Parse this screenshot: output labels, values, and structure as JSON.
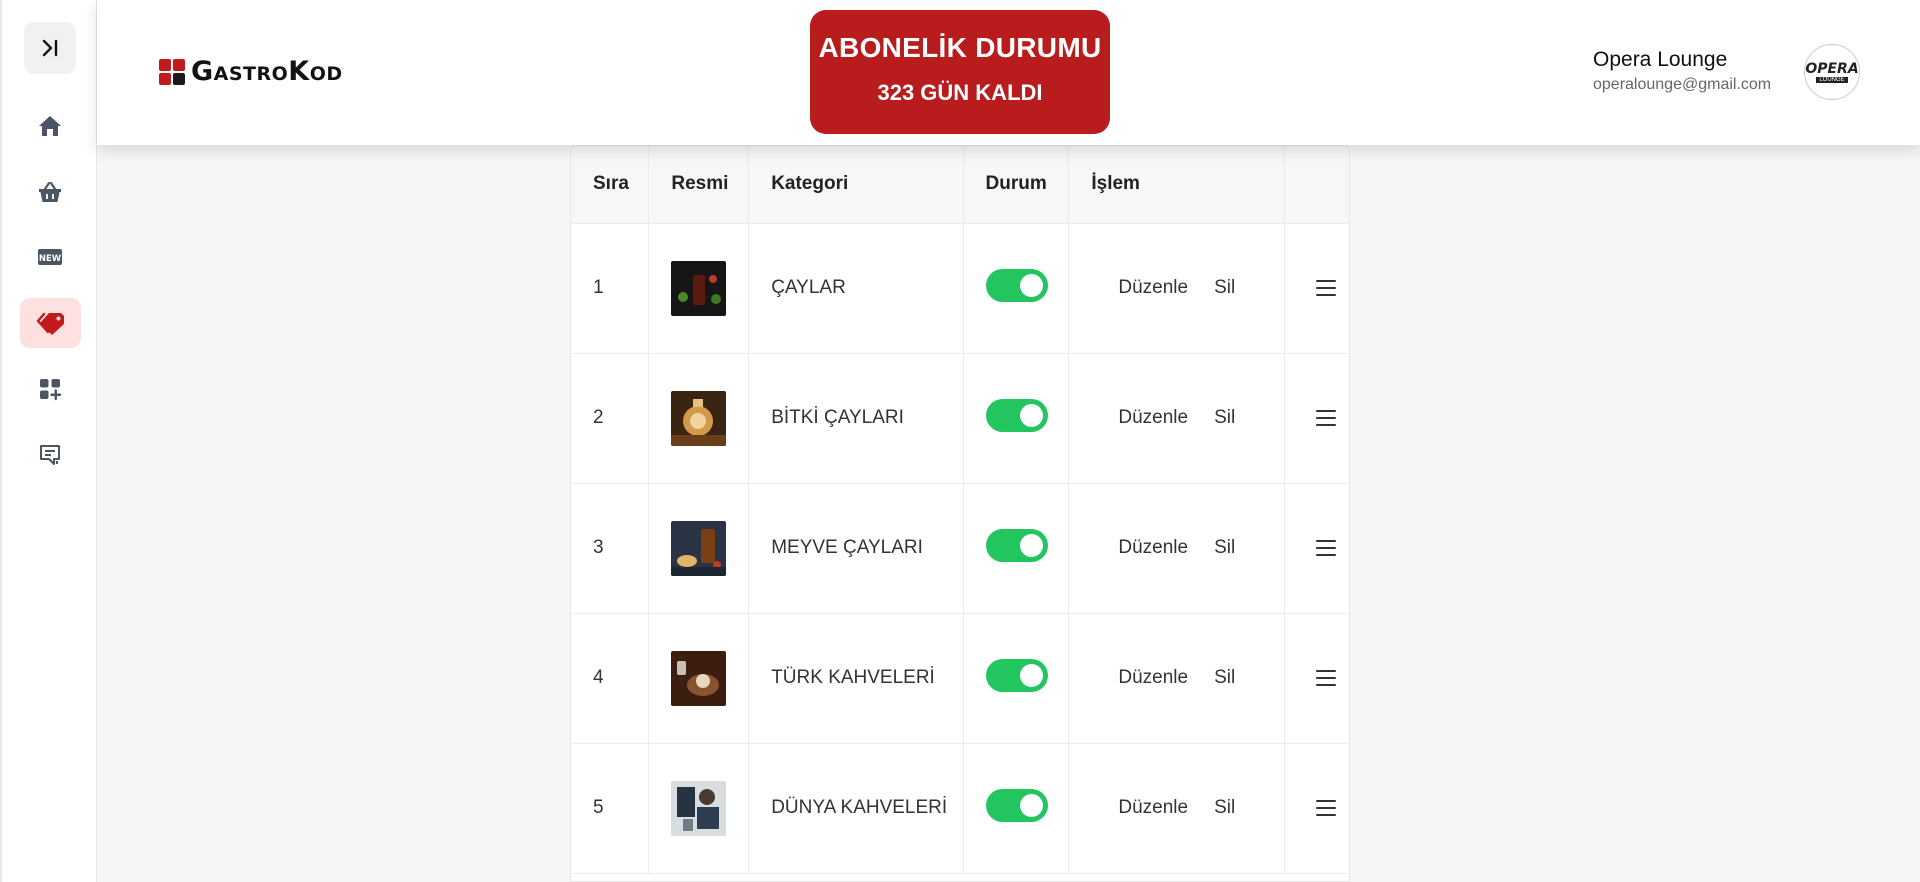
{
  "brand": {
    "name": "GastroKod"
  },
  "subscription": {
    "title": "ABONELİK DURUMU",
    "remaining": "323 GÜN KALDI",
    "color": "#b91c1c"
  },
  "user": {
    "name": "Opera Lounge",
    "email": "operalounge@gmail.com",
    "avatar_text": "OPERA",
    "avatar_sub": "LOUNGE"
  },
  "sidebar": {
    "items": [
      {
        "icon": "sidebar-toggle-icon"
      },
      {
        "icon": "home-icon"
      },
      {
        "icon": "basket-icon"
      },
      {
        "icon": "new-badge-icon"
      },
      {
        "icon": "tags-icon",
        "active": true
      },
      {
        "icon": "add-widget-icon"
      },
      {
        "icon": "feedback-icon"
      }
    ]
  },
  "table": {
    "headers": [
      "Sıra",
      "Resmi",
      "Kategori",
      "Durum",
      "İşlem",
      ""
    ],
    "rows": [
      {
        "order": "1",
        "category": "ÇAYLAR",
        "active": true,
        "edit": "Düzenle",
        "delete": "Sil"
      },
      {
        "order": "2",
        "category": "BİTKİ ÇAYLARI",
        "active": true,
        "edit": "Düzenle",
        "delete": "Sil"
      },
      {
        "order": "3",
        "category": "MEYVE ÇAYLARI",
        "active": true,
        "edit": "Düzenle",
        "delete": "Sil"
      },
      {
        "order": "4",
        "category": "TÜRK KAHVELERİ",
        "active": true,
        "edit": "Düzenle",
        "delete": "Sil"
      },
      {
        "order": "5",
        "category": "DÜNYA KAHVELERİ",
        "active": true,
        "edit": "Düzenle",
        "delete": "Sil"
      }
    ]
  },
  "colors": {
    "toggle_on": "#22c55e",
    "accent": "#b91c1c",
    "active_nav_bg": "#fde0e0"
  }
}
